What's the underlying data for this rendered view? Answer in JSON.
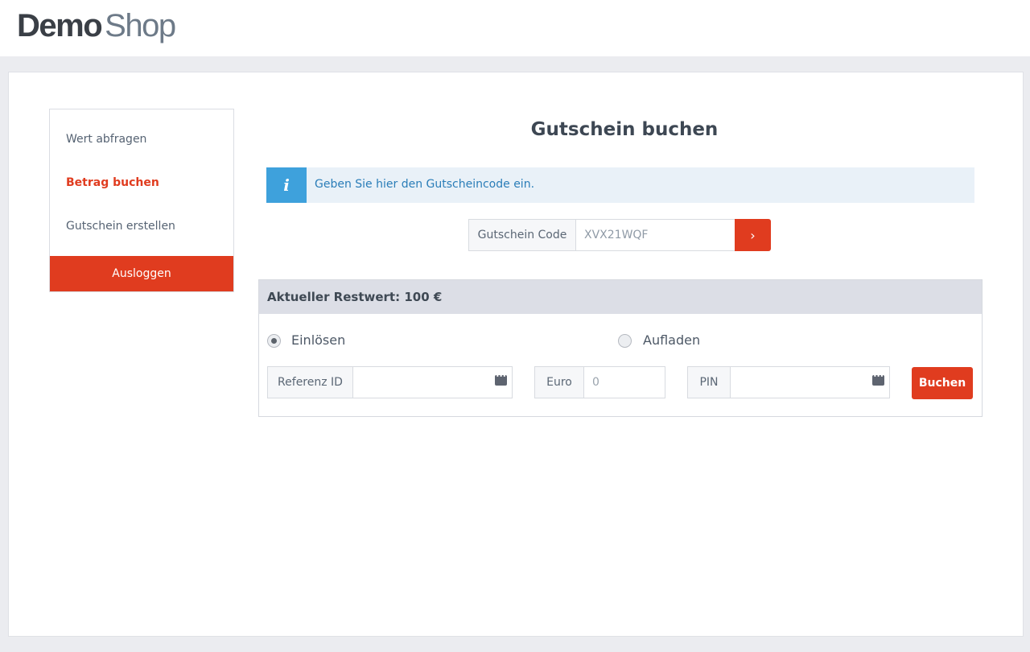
{
  "brand": {
    "part1": "Demo",
    "part2": "Shop"
  },
  "sidebar": {
    "items": [
      {
        "label": "Wert abfragen",
        "active": false
      },
      {
        "label": "Betrag buchen",
        "active": true
      },
      {
        "label": "Gutschein erstellen",
        "active": false
      }
    ],
    "logout_label": "Ausloggen"
  },
  "main": {
    "title": "Gutschein buchen",
    "info": {
      "icon": "info-icon",
      "glyph": "i",
      "text": "Geben Sie hier den Gutscheincode ein."
    },
    "code": {
      "label": "Gutschein Code",
      "value": "XVX21WQF",
      "submit_glyph": "›"
    }
  },
  "panel": {
    "header": "Aktueller Restwert: 100 €",
    "radios": [
      {
        "label": "Einlösen",
        "checked": true
      },
      {
        "label": "Aufladen",
        "checked": false
      }
    ],
    "fields": {
      "reference": {
        "label": "Referenz ID",
        "value": ""
      },
      "amount": {
        "label": "Euro",
        "placeholder": "0"
      },
      "pin": {
        "label": "PIN",
        "value": ""
      }
    },
    "submit_label": "Buchen"
  },
  "colors": {
    "accent": "#e03c1f",
    "info": "#3ea1dc",
    "info_bg": "#e9f1f8"
  }
}
